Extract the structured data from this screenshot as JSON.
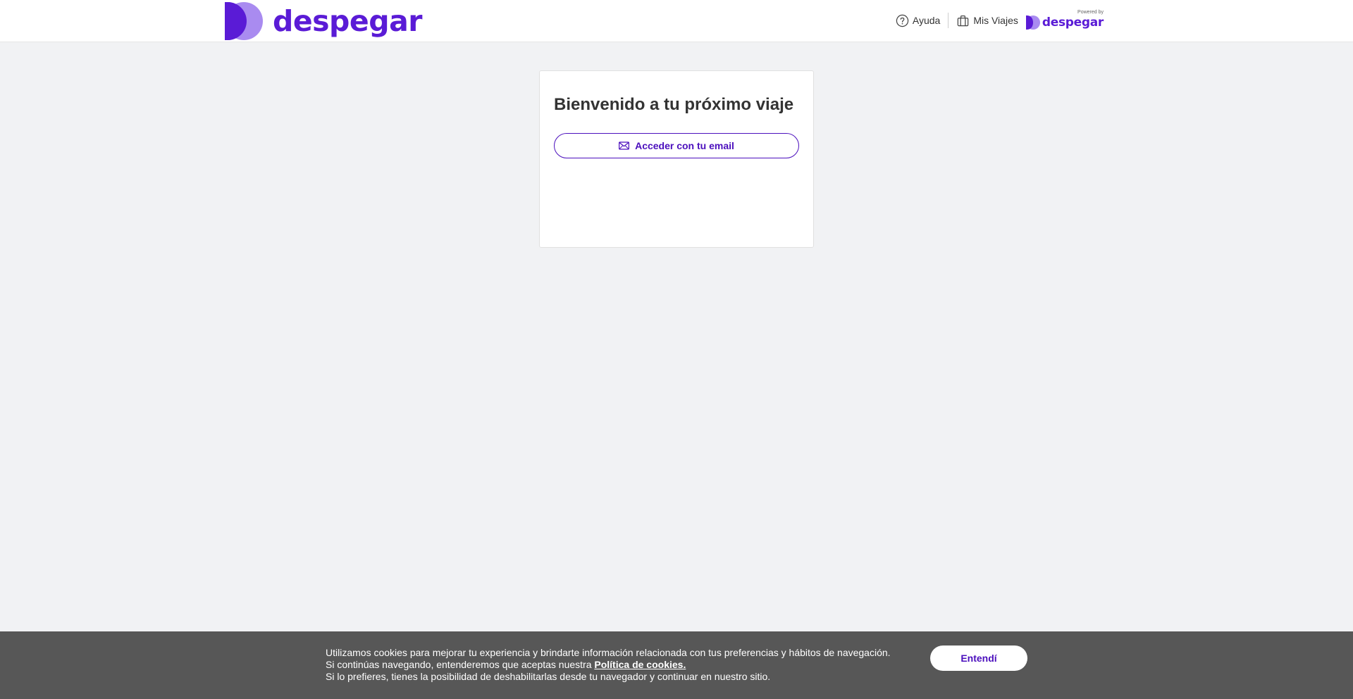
{
  "header": {
    "logo_text": "despegar",
    "nav": {
      "help_label": "Ayuda",
      "trips_label": "Mis Viajes"
    },
    "powered": {
      "label": "Powered by",
      "brand": "despegar"
    }
  },
  "login": {
    "title": "Bienvenido a tu próximo viaje",
    "email_button_label": "Acceder con tu email"
  },
  "cookie_banner": {
    "line1": "Utilizamos cookies para mejorar tu experiencia y brindarte información relacionada con tus preferencias y hábitos de navegación.",
    "line2_prefix": "Si continúas navegando, entenderemos que aceptas nuestra ",
    "policy_link": "Política de cookies.",
    "line3": "Si lo prefieres, tienes la posibilidad de deshabilitarlas desde tu navegador y continuar en nuestro sitio.",
    "accept_label": "Entendí"
  },
  "colors": {
    "brand_primary": "#5a1bd6",
    "brand_secondary": "#a98bf0",
    "button_text": "#4b0fbd",
    "page_background": "#f1f2f4",
    "cookie_background": "#575757"
  },
  "icons": {
    "help": "question-circle-icon",
    "trips": "suitcase-icon",
    "email": "envelope-icon"
  }
}
